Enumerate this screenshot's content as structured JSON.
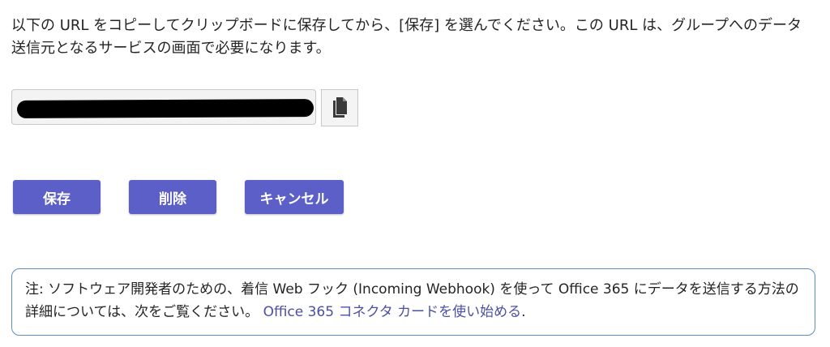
{
  "instructions": {
    "text": "以下の URL をコピーしてクリップボードに保存してから、[保存] を選んでください。この URL は、グループへのデータ送信元となるサービスの画面で必要になります。"
  },
  "url_field": {
    "value": "",
    "redacted": true
  },
  "copy_button": {
    "icon": "copy-icon"
  },
  "actions": {
    "save_label": "保存",
    "delete_label": "削除",
    "cancel_label": "キャンセル"
  },
  "note": {
    "prefix": "注: ソフトウェア開発者のための、着信 Web フック (Incoming Webhook) を使って Office 365 にデータを送信する方法の詳細については、次をご覧ください。",
    "link_text": "Office 365 コネクタ カードを使い始める",
    "suffix": "."
  },
  "colors": {
    "primary_button": "#5b5fc7",
    "link": "#4a4fa8",
    "note_border": "#5b8ec7"
  }
}
